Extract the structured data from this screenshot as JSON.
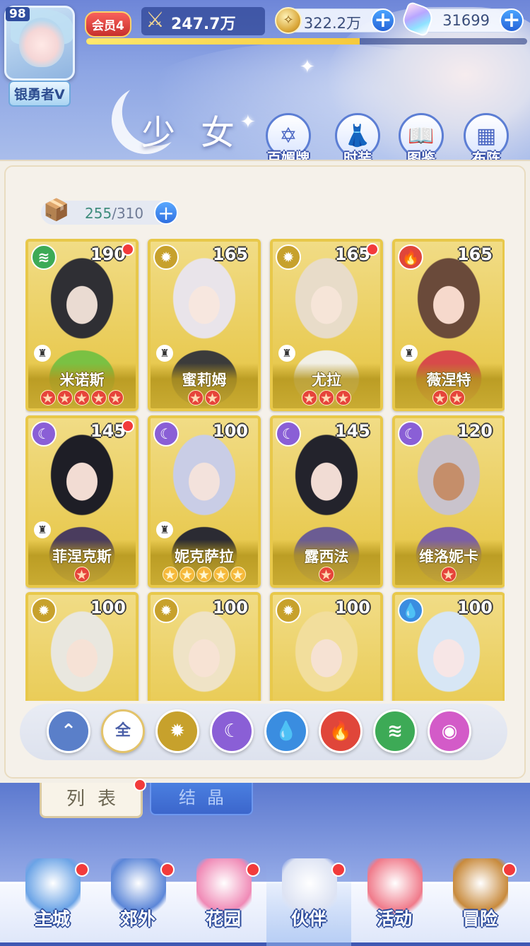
{
  "player": {
    "level": "98",
    "rank_title": "银勇者V",
    "vip_label": "会员4",
    "power": "247.7万",
    "xp_fraction": 0.62
  },
  "resources": {
    "coins": "322.2万",
    "gems": "31699"
  },
  "header": {
    "title": "少女",
    "buttons": [
      {
        "label": "百媚牌",
        "icon": "star-of-david-icon"
      },
      {
        "label": "时装",
        "icon": "clothes-icon"
      },
      {
        "label": "图鉴",
        "icon": "book-icon"
      },
      {
        "label": "布阵",
        "icon": "grid-icon"
      }
    ]
  },
  "inventory": {
    "current": "255",
    "max": "310"
  },
  "cards": [
    {
      "name": "米诺斯",
      "level": "190",
      "element": "wind",
      "color": "#3daa56",
      "stars": 5,
      "star_type": "red",
      "dot": true,
      "role": true
    },
    {
      "name": "蜜莉姆",
      "level": "165",
      "element": "light",
      "color": "#c7a12c",
      "stars": 2,
      "star_type": "red",
      "dot": false,
      "role": true
    },
    {
      "name": "尤拉",
      "level": "165",
      "element": "light",
      "color": "#c7a12c",
      "stars": 3,
      "star_type": "red",
      "dot": true,
      "role": true
    },
    {
      "name": "薇涅特",
      "level": "165",
      "element": "fire",
      "color": "#e0463a",
      "stars": 2,
      "star_type": "red",
      "dot": false,
      "role": true
    },
    {
      "name": "菲涅克斯",
      "level": "145",
      "element": "dark",
      "color": "#8a5fd6",
      "stars": 1,
      "star_type": "red",
      "dot": true,
      "role": true
    },
    {
      "name": "妮克萨拉",
      "level": "100",
      "element": "dark",
      "color": "#8a5fd6",
      "stars": 5,
      "star_type": "gold",
      "dot": false,
      "role": true
    },
    {
      "name": "露西法",
      "level": "145",
      "element": "dark",
      "color": "#8a5fd6",
      "stars": 1,
      "star_type": "red",
      "dot": false,
      "role": false
    },
    {
      "name": "维洛妮卡",
      "level": "120",
      "element": "dark",
      "color": "#8a5fd6",
      "stars": 1,
      "star_type": "red",
      "dot": false,
      "role": false
    },
    {
      "name": "",
      "level": "100",
      "element": "light",
      "color": "#c7a12c",
      "stars": 0,
      "star_type": "red",
      "dot": false,
      "role": false
    },
    {
      "name": "",
      "level": "100",
      "element": "light",
      "color": "#c7a12c",
      "stars": 0,
      "star_type": "red",
      "dot": false,
      "role": false
    },
    {
      "name": "",
      "level": "100",
      "element": "light",
      "color": "#c7a12c",
      "stars": 0,
      "star_type": "red",
      "dot": false,
      "role": false
    },
    {
      "name": "",
      "level": "100",
      "element": "water",
      "color": "#3a8de0",
      "stars": 0,
      "star_type": "red",
      "dot": false,
      "role": false
    }
  ],
  "filters": [
    {
      "label": "",
      "icon": "star-rank-icon",
      "color": "#5a7fc9"
    },
    {
      "label": "全",
      "icon": "all-icon",
      "color": "#ffffff"
    },
    {
      "label": "",
      "icon": "light-icon",
      "color": "#c7a12c"
    },
    {
      "label": "",
      "icon": "dark-icon",
      "color": "#8a5fd6"
    },
    {
      "label": "",
      "icon": "water-icon",
      "color": "#3a8de0"
    },
    {
      "label": "",
      "icon": "fire-icon",
      "color": "#e0463a"
    },
    {
      "label": "",
      "icon": "wind-icon",
      "color": "#3daa56"
    },
    {
      "label": "",
      "icon": "orbit-icon",
      "color": "#d35bc8"
    }
  ],
  "tabs": [
    {
      "label": "列表"
    },
    {
      "label": "结晶"
    }
  ],
  "nav": [
    {
      "label": "主城",
      "icon": "castle-icon",
      "dot": true,
      "color": "#6aa3e6"
    },
    {
      "label": "郊外",
      "icon": "portal-icon",
      "dot": true,
      "color": "#5b86d8"
    },
    {
      "label": "花园",
      "icon": "heart-icon",
      "dot": true,
      "color": "#f08ab6"
    },
    {
      "label": "伙伴",
      "icon": "partner-icon",
      "dot": true,
      "color": "#dde3f3"
    },
    {
      "label": "活动",
      "icon": "gift-icon",
      "dot": false,
      "color": "#f07a8a"
    },
    {
      "label": "冒险",
      "icon": "compass-icon",
      "dot": true,
      "color": "#c88a3c"
    }
  ]
}
